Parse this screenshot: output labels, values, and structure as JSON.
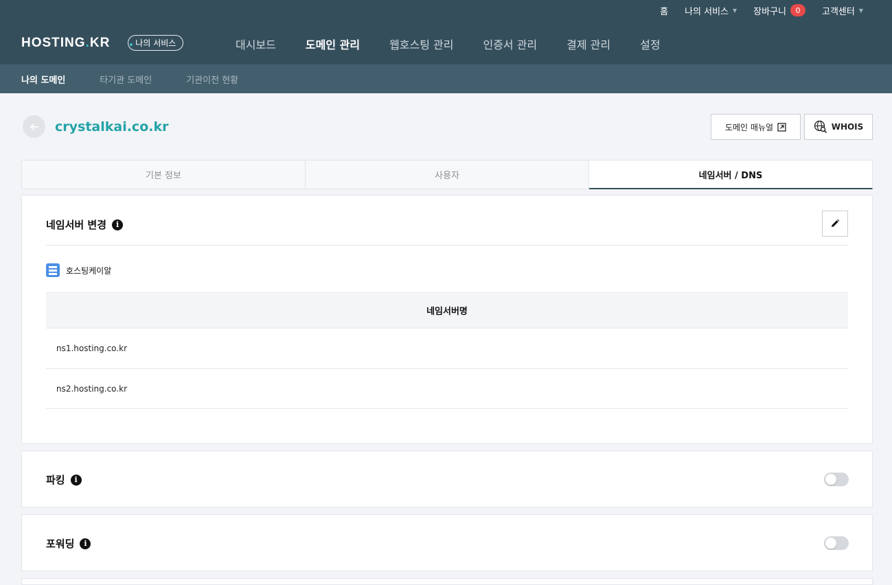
{
  "util": {
    "home": "홈",
    "my_services": "나의 서비스",
    "cart": "장바구니",
    "cart_count": "0",
    "support": "고객센터"
  },
  "brand": {
    "logo_main": "HOSTING",
    "logo_dot": ".",
    "logo_suffix": "KR",
    "pill": "나의 서비스"
  },
  "gnb": [
    {
      "label": "대시보드"
    },
    {
      "label": "도메인 관리"
    },
    {
      "label": "웹호스팅 관리"
    },
    {
      "label": "인증서 관리"
    },
    {
      "label": "결제 관리"
    },
    {
      "label": "설정"
    }
  ],
  "subnav": [
    {
      "label": "나의 도메인"
    },
    {
      "label": "타기관 도메인"
    },
    {
      "label": "기관이전 현황"
    }
  ],
  "domain": {
    "name": "crystalkai.co.kr",
    "manual_button": "도메인 매뉴얼",
    "whois_button": "WHOIS"
  },
  "tabs": [
    {
      "label": "기본 정보"
    },
    {
      "label": "사용자"
    },
    {
      "label": "네임서버 / DNS"
    }
  ],
  "nameserver": {
    "title": "네임서버 변경",
    "provider": "호스팅케이알",
    "column_header": "네임서버명",
    "rows": [
      "ns1.hosting.co.kr",
      "ns2.hosting.co.kr"
    ]
  },
  "parking": {
    "title": "파킹",
    "enabled": false
  },
  "forwarding": {
    "title": "포워딩",
    "enabled": false
  },
  "colors": {
    "header_bg": "#354e5c",
    "subnav_bg": "#435f6d",
    "accent": "#23a3a8",
    "badge": "#e84a4a"
  }
}
